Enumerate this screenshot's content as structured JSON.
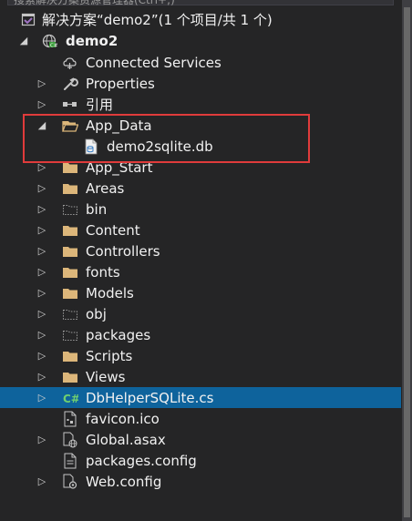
{
  "search": {
    "placeholder": "搜索解决方案资源管理器(Ctrl+;)"
  },
  "tree": {
    "solution": {
      "label": "解决方案“demo2”(1 个项目/共 1 个)"
    },
    "project": {
      "label": "demo2"
    },
    "items": [
      {
        "label": "Connected Services",
        "icon": "connected-services-icon",
        "arrow": "none"
      },
      {
        "label": "Properties",
        "icon": "wrench-icon",
        "arrow": "collapsed"
      },
      {
        "label": "引用",
        "icon": "references-icon",
        "arrow": "collapsed"
      },
      {
        "label": "App_Data",
        "icon": "folder-open-icon",
        "arrow": "expanded"
      },
      {
        "label": "demo2sqlite.db",
        "icon": "database-file-icon",
        "arrow": "none"
      },
      {
        "label": "App_Start",
        "icon": "folder-icon",
        "arrow": "collapsed"
      },
      {
        "label": "Areas",
        "icon": "folder-icon",
        "arrow": "collapsed"
      },
      {
        "label": "bin",
        "icon": "folder-dashed-icon",
        "arrow": "collapsed"
      },
      {
        "label": "Content",
        "icon": "folder-icon",
        "arrow": "collapsed"
      },
      {
        "label": "Controllers",
        "icon": "folder-icon",
        "arrow": "collapsed"
      },
      {
        "label": "fonts",
        "icon": "folder-icon",
        "arrow": "collapsed"
      },
      {
        "label": "Models",
        "icon": "folder-icon",
        "arrow": "collapsed"
      },
      {
        "label": "obj",
        "icon": "folder-dashed-icon",
        "arrow": "collapsed"
      },
      {
        "label": "packages",
        "icon": "folder-dashed-icon",
        "arrow": "collapsed"
      },
      {
        "label": "Scripts",
        "icon": "folder-icon",
        "arrow": "collapsed"
      },
      {
        "label": "Views",
        "icon": "folder-icon",
        "arrow": "collapsed"
      },
      {
        "label": "DbHelperSQLite.cs",
        "icon": "csharp-file-icon",
        "arrow": "collapsed",
        "selected": true
      },
      {
        "label": "favicon.ico",
        "icon": "ico-file-icon",
        "arrow": "none"
      },
      {
        "label": "Global.asax",
        "icon": "global-asax-icon",
        "arrow": "collapsed"
      },
      {
        "label": "packages.config",
        "icon": "config-file-icon",
        "arrow": "none"
      },
      {
        "label": "Web.config",
        "icon": "web-config-icon",
        "arrow": "collapsed"
      }
    ]
  },
  "colors": {
    "background": "#252526",
    "selected": "#0e639c",
    "folder": "#dcb67a",
    "highlight": "#e03b3b"
  }
}
